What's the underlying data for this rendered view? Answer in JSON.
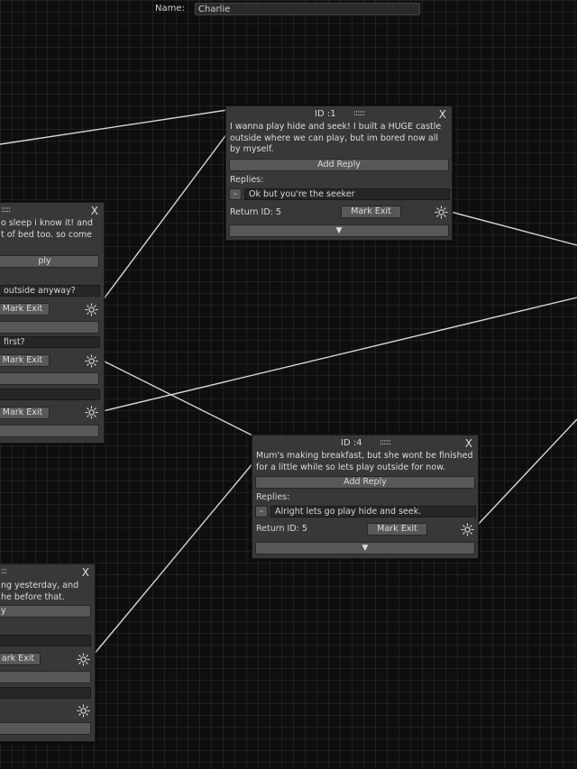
{
  "header": {
    "name_label": "Name:",
    "name_value": "Charlie"
  },
  "node1": {
    "id_label": "ID :1",
    "handle": "::::::",
    "close": "X",
    "text": "I wanna play hide and seek! I built a HUGE castle outside where we can play, but im bored now all by myself.",
    "add_reply": "Add Reply",
    "replies_label": "Replies:",
    "reply_remove": "-",
    "reply_text": "Ok but you're  the seeker",
    "return_id": "Return ID: 5",
    "mark_exit": "Mark Exit",
    "collapse": "▼"
  },
  "node4": {
    "id_label": "ID :4",
    "handle": "::::::",
    "close": "X",
    "text": "Mum's making breakfast, but she wont be finished for a little while so lets play outside for now.",
    "add_reply": "Add Reply",
    "replies_label": "Replies:",
    "reply_remove": "-",
    "reply_text": "Alright lets go play hide and seek.",
    "return_id": "Return ID: 5",
    "mark_exit": "Mark Exit",
    "collapse": "▼"
  },
  "left_node_a": {
    "handle": ":::::",
    "close": "X",
    "text_line1": "o sleep i know it! and",
    "text_line2": "t of bed too. so come",
    "add_reply": "ply",
    "reply1_text": "outside anyway?",
    "mark_exit": "Mark Exit",
    "reply2_text": "first?"
  },
  "left_node_b": {
    "handle": ":::",
    "close": "X",
    "text_line1": "ng yesterday, and",
    "text_line2": "he before that.",
    "add_reply": "y",
    "mark_exit": "ark Exit"
  },
  "colors": {
    "background": "#0e0e0e",
    "node": "#383838",
    "button": "#585858",
    "field": "#262626",
    "wire": "#d6d6d6"
  }
}
